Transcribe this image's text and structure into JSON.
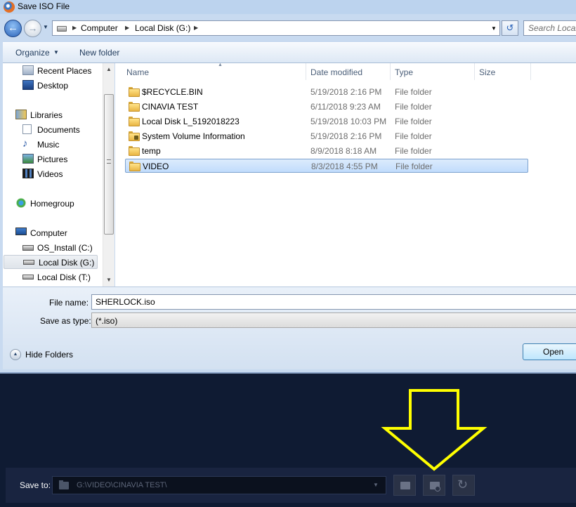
{
  "dialog": {
    "title": "Save ISO File",
    "address": {
      "crumbs": [
        "Computer",
        "Local Disk (G:)"
      ]
    },
    "search_placeholder": "Search Local",
    "toolbar": {
      "organize": "Organize",
      "new_folder": "New folder"
    },
    "nav": {
      "items": [
        {
          "label": "Recent Places",
          "icon": "recent-places-icon"
        },
        {
          "label": "Desktop",
          "icon": "desktop-icon"
        },
        {
          "label": "Libraries",
          "icon": "libraries-icon"
        },
        {
          "label": "Documents",
          "icon": "documents-icon"
        },
        {
          "label": "Music",
          "icon": "music-icon"
        },
        {
          "label": "Pictures",
          "icon": "pictures-icon"
        },
        {
          "label": "Videos",
          "icon": "videos-icon"
        },
        {
          "label": "Homegroup",
          "icon": "homegroup-icon"
        },
        {
          "label": "Computer",
          "icon": "computer-icon"
        },
        {
          "label": "OS_Install (C:)",
          "icon": "drive-c-icon"
        },
        {
          "label": "Local Disk (G:)",
          "icon": "drive-icon",
          "selected": true
        },
        {
          "label": "Local Disk (T:)",
          "icon": "drive-icon"
        }
      ]
    },
    "columns": [
      "Name",
      "Date modified",
      "Type",
      "Size"
    ],
    "files": [
      {
        "name": "$RECYCLE.BIN",
        "date": "5/19/2018 2:16 PM",
        "type": "File folder"
      },
      {
        "name": "CINAVIA TEST",
        "date": "6/11/2018 9:23 AM",
        "type": "File folder"
      },
      {
        "name": "Local Disk L_5192018223",
        "date": "5/19/2018 10:03 PM",
        "type": "File folder"
      },
      {
        "name": "System Volume Information",
        "date": "5/19/2018 2:16 PM",
        "type": "File folder",
        "locked": true
      },
      {
        "name": "temp",
        "date": "8/9/2018 8:18 AM",
        "type": "File folder"
      },
      {
        "name": "VIDEO",
        "date": "8/3/2018 4:55 PM",
        "type": "File folder",
        "selected": true
      }
    ],
    "file_name_label": "File name:",
    "file_name_value": "SHERLOCK.iso",
    "save_as_type_label": "Save as type:",
    "save_as_type_value": "(*.iso)",
    "hide_folders": "Hide Folders",
    "open_button": "Open"
  },
  "app": {
    "save_to_label": "Save to:",
    "save_to_path": "G:\\VIDEO\\CINAVIA TEST\\",
    "buttons": [
      "browse-folder-icon",
      "new-folder-icon",
      "refresh-icon"
    ]
  },
  "annotation": {
    "arrow_color": "#ffff00"
  }
}
